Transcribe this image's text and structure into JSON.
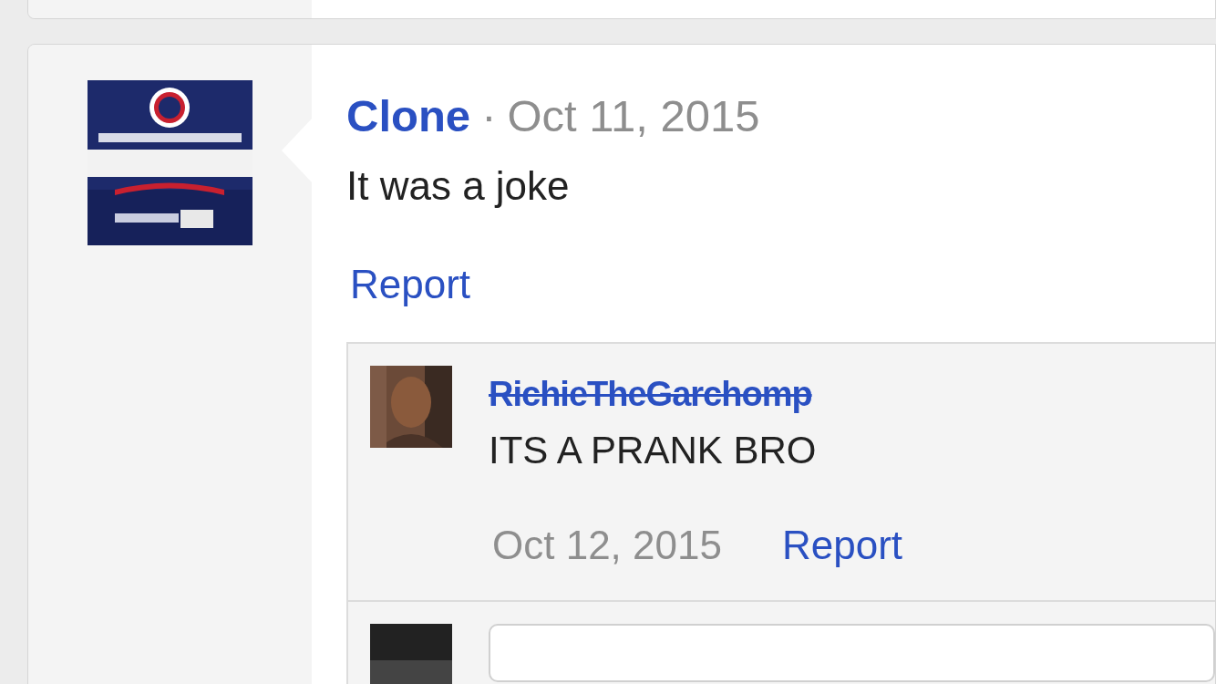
{
  "comment": {
    "author": "Clone",
    "separator": "·",
    "date": "Oct 11, 2015",
    "body": "It was a joke",
    "report": "Report"
  },
  "replies": [
    {
      "author": "RichieTheGarchomp",
      "struck": true,
      "body": "ITS A PRANK BRO",
      "date": "Oct 12, 2015",
      "report": "Report"
    }
  ]
}
